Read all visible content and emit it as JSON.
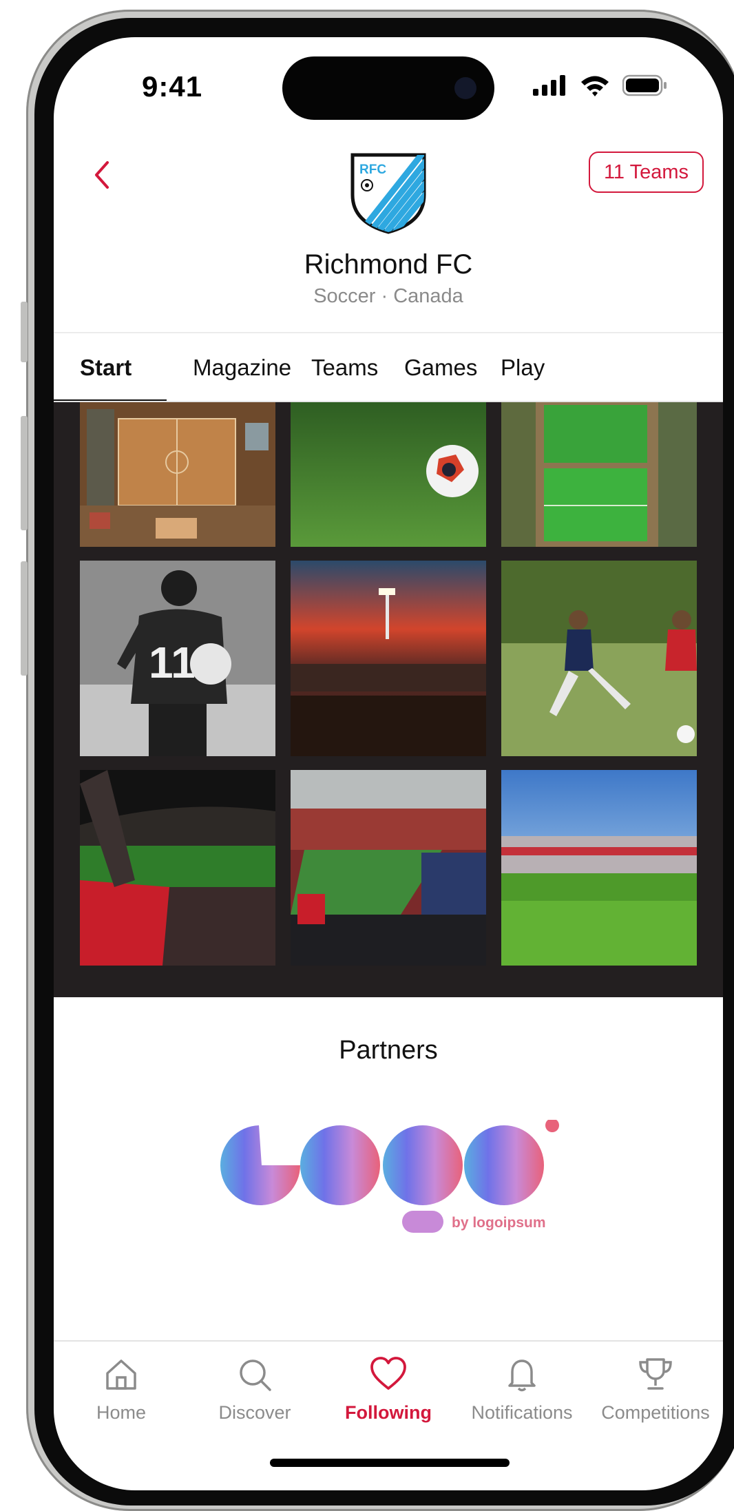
{
  "status": {
    "time": "9:41"
  },
  "header": {
    "crest_text": "RFC",
    "team_name": "Richmond FC",
    "team_meta": "Soccer · Canada",
    "teams_button": "11 Teams"
  },
  "tabs": [
    {
      "label": "Start",
      "active": true
    },
    {
      "label": "Magazine",
      "active": false
    },
    {
      "label": "Teams",
      "active": false
    },
    {
      "label": "Games",
      "active": false
    },
    {
      "label": "Play",
      "active": false
    }
  ],
  "gallery": [
    {
      "name": "aerial-pitch-photo"
    },
    {
      "name": "ball-on-grass-photo"
    },
    {
      "name": "aerial-fields-photo"
    },
    {
      "name": "player-number-11-photo",
      "jersey_number": "11"
    },
    {
      "name": "stadium-sunset-photo"
    },
    {
      "name": "players-tackle-photo"
    },
    {
      "name": "fans-red-stadium-photo"
    },
    {
      "name": "stadium-crowd-photo"
    },
    {
      "name": "grass-closeup-photo"
    }
  ],
  "partners": {
    "title": "Partners",
    "logo_byline": "by logoipsum"
  },
  "tabbar": [
    {
      "label": "Home",
      "icon": "home-icon",
      "active": false
    },
    {
      "label": "Discover",
      "icon": "search-icon",
      "active": false
    },
    {
      "label": "Following",
      "icon": "heart-icon",
      "active": true
    },
    {
      "label": "Notifications",
      "icon": "bell-icon",
      "active": false
    },
    {
      "label": "Competitions",
      "icon": "trophy-icon",
      "active": false
    }
  ],
  "colors": {
    "accent": "#d3183c",
    "gallery_bg": "#231f20",
    "crest_blue": "#2ea8e0",
    "inactive": "#8b8b8b"
  }
}
